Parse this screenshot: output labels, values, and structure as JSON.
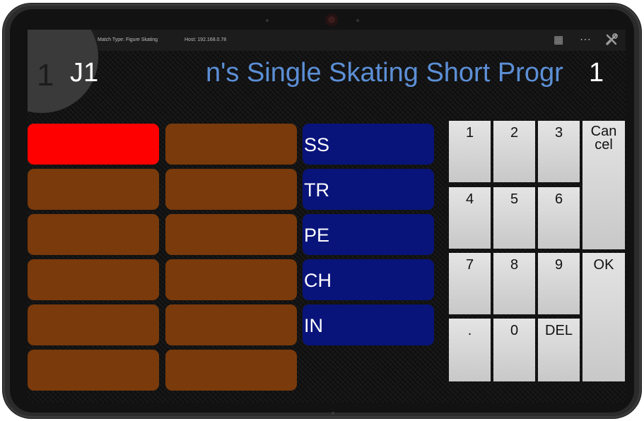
{
  "statusbar": {
    "wifi_icon": "((ı))",
    "match_type": "Match Type: Figure Skating",
    "host": "Host: 192.168.0.78",
    "icons": [
      "film-icon",
      "more-dots-icon",
      "tools-icon"
    ]
  },
  "header": {
    "corner_number": "1",
    "judge": "J1",
    "title": "n's Single Skating Short Progr",
    "right_number": "1"
  },
  "slots": {
    "active_color": "#ff0000",
    "inactive_color": "#7a3a0b",
    "rows": 6,
    "columns": 2
  },
  "components": [
    "SS",
    "TR",
    "PE",
    "CH",
    "IN"
  ],
  "keypad": {
    "k1": "1",
    "k2": "2",
    "k3": "3",
    "k4": "4",
    "k5": "5",
    "k6": "6",
    "k7": "7",
    "k8": "8",
    "k9": "9",
    "dot": ".",
    "k0": "0",
    "del": "DEL",
    "cancel_line1": "Can",
    "cancel_line2": "cel",
    "ok": "OK"
  },
  "colors": {
    "title_blue": "#5c8fd6",
    "component_blue": "#08147a",
    "wifi_blue": "#3a6fd8"
  }
}
